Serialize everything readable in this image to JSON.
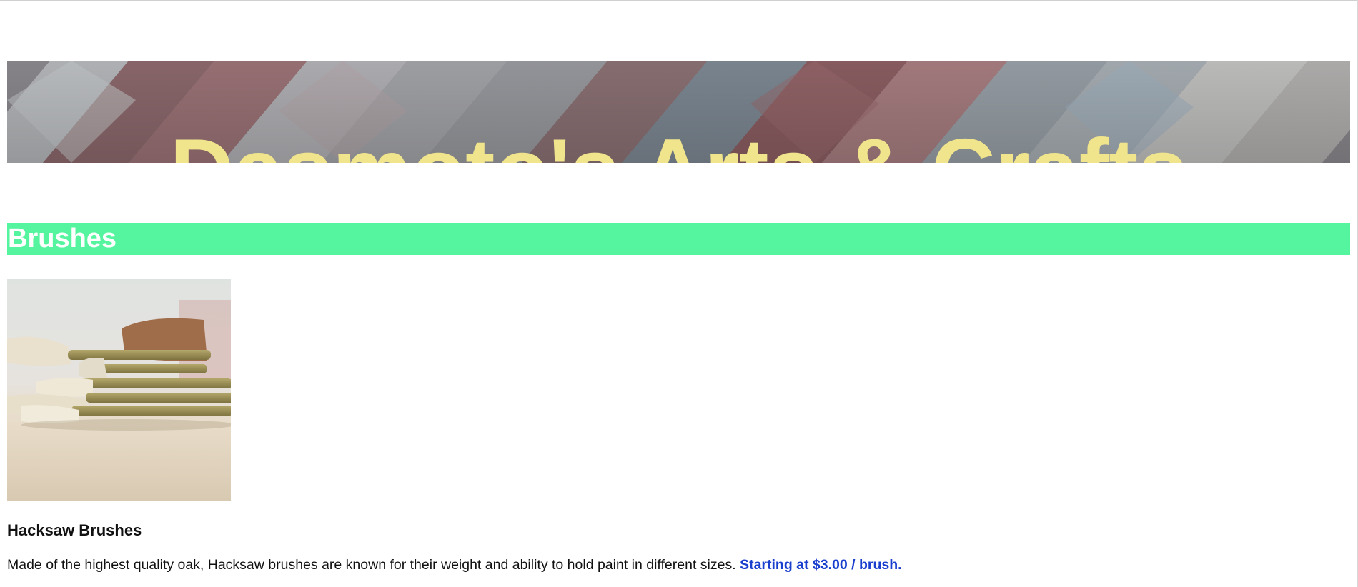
{
  "header": {
    "title": "Dasmoto's Arts & Crafts"
  },
  "sections": [
    {
      "heading": "Brushes",
      "product": {
        "name": "Hacksaw Brushes",
        "description": "Made of the highest quality oak, Hacksaw brushes are known for their weight and ability to hold paint in different sizes.",
        "price": "Starting at $3.00 / brush."
      }
    }
  ],
  "colors": {
    "title_text": "#f0e48c",
    "section_bg": "#55f59f",
    "section_text": "#ffffff",
    "price_text": "#1a3fcf"
  },
  "icons": {
    "banner_image": "brick-pavement-image",
    "product_image": "paintbrushes-image"
  }
}
